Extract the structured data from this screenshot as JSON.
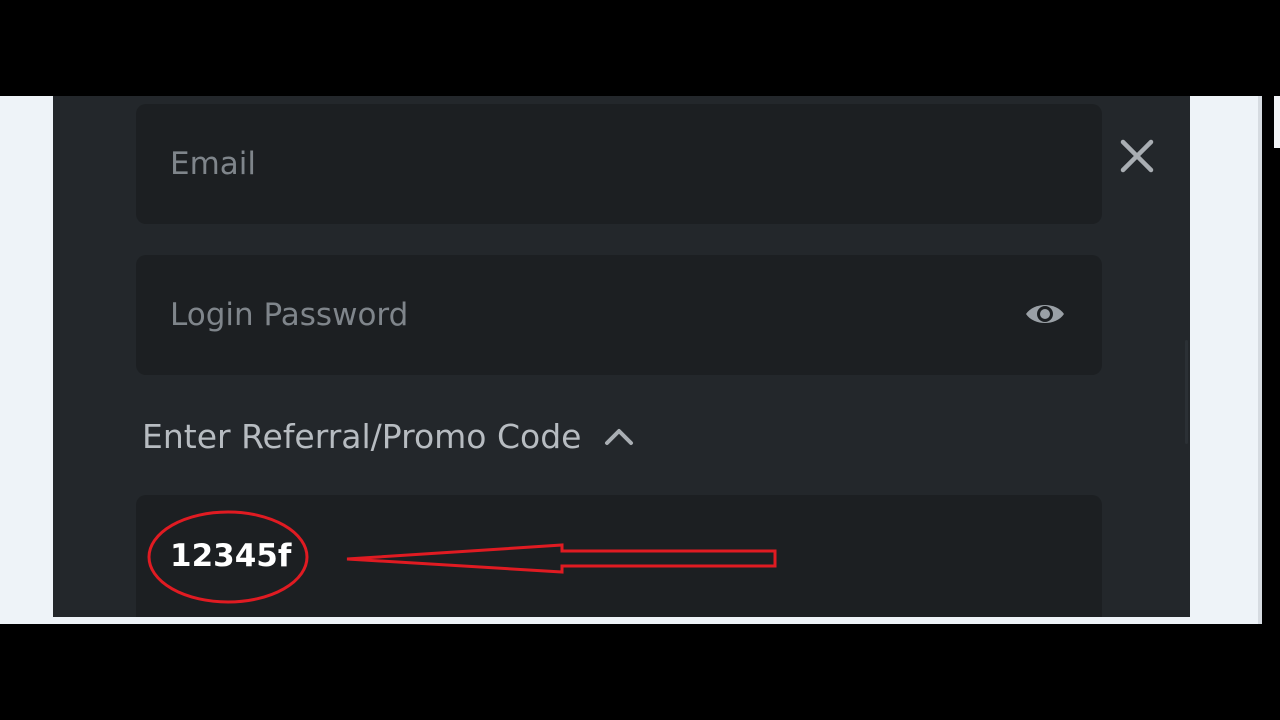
{
  "form": {
    "email_placeholder": "Email",
    "password_placeholder": "Login Password",
    "promo_toggle_label": "Enter Referral/Promo Code",
    "promo_code_value": "12345f"
  },
  "icons": {
    "close": "close-icon",
    "eye": "eye-icon",
    "chevron": "chevron-up-icon"
  },
  "colors": {
    "modal_background": "#23272b",
    "field_background": "#1c1f22",
    "placeholder_text": "#7f858b",
    "annotation_red": "#e01b22"
  }
}
